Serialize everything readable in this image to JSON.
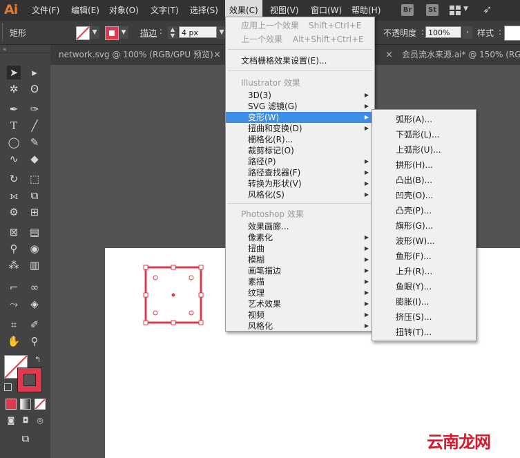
{
  "app": {
    "logo": "Ai"
  },
  "menubar": {
    "items": [
      "文件(F)",
      "编辑(E)",
      "对象(O)",
      "文字(T)",
      "选择(S)",
      "效果(C)",
      "视图(V)",
      "窗口(W)",
      "帮助(H)"
    ],
    "icons": [
      "Br",
      "St"
    ]
  },
  "control": {
    "tool_name": "矩形",
    "stroke_label": "描边",
    "stroke_value": "4 px",
    "opacity_label": "不透明度",
    "opacity_value": "100%",
    "style_label": "样式",
    "accent_color": "#e0394f"
  },
  "tabs": [
    "network.svg @ 100% (RGB/GPU 预览)",
    "会员流水来源.ai* @ 150% (RG"
  ],
  "effect_menu": {
    "top_items": [
      {
        "label": "应用上一个效果",
        "shortcut": "Shift+Ctrl+E"
      },
      {
        "label": "上一个效果",
        "shortcut": "Alt+Shift+Ctrl+E"
      }
    ],
    "doc_raster": "文档栅格效果设置(E)...",
    "illustrator_header": "Illustrator 效果",
    "illustrator_items": [
      "3D(3)",
      "SVG 滤镜(G)",
      "变形(W)",
      "扭曲和变换(D)",
      "栅格化(R)...",
      "裁剪标记(O)",
      "路径(P)",
      "路径查找器(F)",
      "转换为形状(V)",
      "风格化(S)"
    ],
    "photoshop_header": "Photoshop 效果",
    "photoshop_items": [
      "效果画廊...",
      "像素化",
      "扭曲",
      "模糊",
      "画笔描边",
      "素描",
      "纹理",
      "艺术效果",
      "视频",
      "风格化"
    ]
  },
  "warp_submenu": {
    "items": [
      "弧形(A)...",
      "下弧形(L)...",
      "上弧形(U)...",
      "拱形(H)...",
      "凸出(B)...",
      "凹壳(O)...",
      "凸壳(P)...",
      "旗形(G)...",
      "波形(W)...",
      "鱼形(F)...",
      "上升(R)...",
      "鱼眼(Y)...",
      "膨胀(I)...",
      "挤压(S)...",
      "扭转(T)..."
    ]
  },
  "watermark": "云南龙网"
}
